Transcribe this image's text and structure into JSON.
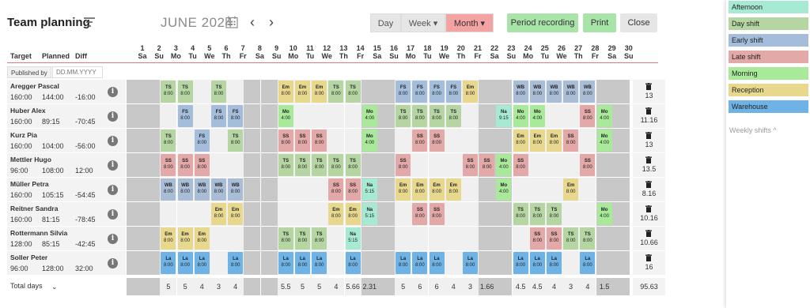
{
  "header": {
    "title": "Team planning",
    "month": "JUNE 2024",
    "prev": "‹",
    "next": "›",
    "views": [
      "Day",
      "Week ▾",
      "Month ▾"
    ],
    "active_view": "Month",
    "period_recording": "Period recording",
    "print": "Print",
    "close": "Close"
  },
  "columns": {
    "target": "Target",
    "planned": "Planned",
    "diff": "Diff"
  },
  "published_by": "Published by",
  "published_placeholder": "DD.MM.YYYY",
  "days": [
    {
      "n": "1",
      "d": "Sa"
    },
    {
      "n": "2",
      "d": "Su"
    },
    {
      "n": "3",
      "d": "Mo"
    },
    {
      "n": "4",
      "d": "Tu"
    },
    {
      "n": "5",
      "d": "We"
    },
    {
      "n": "6",
      "d": "Th"
    },
    {
      "n": "7",
      "d": "Fr"
    },
    {
      "n": "8",
      "d": "Sa"
    },
    {
      "n": "9",
      "d": "Su"
    },
    {
      "n": "10",
      "d": "Mo"
    },
    {
      "n": "11",
      "d": "Tu"
    },
    {
      "n": "12",
      "d": "We"
    },
    {
      "n": "13",
      "d": "Th"
    },
    {
      "n": "14",
      "d": "Fr"
    },
    {
      "n": "15",
      "d": "Sa"
    },
    {
      "n": "16",
      "d": "Su"
    },
    {
      "n": "17",
      "d": "Mo"
    },
    {
      "n": "18",
      "d": "Tu"
    },
    {
      "n": "19",
      "d": "We"
    },
    {
      "n": "20",
      "d": "Th"
    },
    {
      "n": "21",
      "d": "Fr"
    },
    {
      "n": "22",
      "d": "Sa"
    },
    {
      "n": "23",
      "d": "Su"
    },
    {
      "n": "24",
      "d": "Mo"
    },
    {
      "n": "25",
      "d": "Tu"
    },
    {
      "n": "26",
      "d": "We"
    },
    {
      "n": "27",
      "d": "Th"
    },
    {
      "n": "28",
      "d": "Fr"
    },
    {
      "n": "29",
      "d": "Sa"
    },
    {
      "n": "30",
      "d": "Su"
    }
  ],
  "shift_colors": {
    "TS": "#b5d6a3",
    "FS": "#a3bddb",
    "Em": "#e8d88e",
    "SS": "#e3a8a8",
    "WB": "#a9bdd6",
    "La": "#6fb3e6",
    "Mo": "#a8e99a",
    "Na": "#a7ead4"
  },
  "employees": [
    {
      "name": "Aregger Pascal",
      "target": "160:00",
      "planned": "144:00",
      "diff": "-16:00",
      "total": "13",
      "shifts": {
        "3": [
          "TS",
          "8:00"
        ],
        "4": [
          "TS",
          "8:00"
        ],
        "6": [
          "TS",
          "8:00"
        ],
        "10": [
          "Em",
          "8:00"
        ],
        "11": [
          "Em",
          "8:00"
        ],
        "12": [
          "Em",
          "8:00"
        ],
        "13": [
          "TS",
          "8:00"
        ],
        "14": [
          "TS",
          "8:00"
        ],
        "17": [
          "FS",
          "8:00"
        ],
        "18": [
          "FS",
          "8:00"
        ],
        "19": [
          "FS",
          "8:00"
        ],
        "20": [
          "FS",
          "8:00"
        ],
        "21": [
          "Em",
          "8:00"
        ],
        "24": [
          "WB",
          "8:00"
        ],
        "25": [
          "WB",
          "8:00"
        ],
        "26": [
          "WB",
          "8:00"
        ],
        "27": [
          "WB",
          "8:00"
        ],
        "28": [
          "WB",
          "8:00"
        ]
      }
    },
    {
      "name": "Huber Alex",
      "target": "160:00",
      "planned": "89:15",
      "diff": "-70:45",
      "total": "11.16",
      "shifts": {
        "4": [
          "FS",
          "8:00"
        ],
        "6": [
          "FS",
          "8:00"
        ],
        "7": [
          "FS",
          "8:00"
        ],
        "10": [
          "Mo",
          "4:00"
        ],
        "15": [
          "Mo",
          "4:00"
        ],
        "17": [
          "TS",
          "8:00"
        ],
        "18": [
          "TS",
          "8:00"
        ],
        "19": [
          "TS",
          "8:00"
        ],
        "20": [
          "TS",
          "8:00"
        ],
        "23": [
          "Na",
          "9:15"
        ],
        "24": [
          "Mo",
          "4:00"
        ],
        "25": [
          "Mo",
          "4:00"
        ],
        "28": [
          "SS",
          "8:00"
        ],
        "29": [
          "Mo",
          "4:00"
        ]
      }
    },
    {
      "name": "Kurz Pia",
      "target": "160:00",
      "planned": "104:00",
      "diff": "-56:00",
      "total": "13",
      "shifts": {
        "3": [
          "TS",
          "8:00"
        ],
        "5": [
          "FS",
          "8:00"
        ],
        "7": [
          "TS",
          "8:00"
        ],
        "10": [
          "SS",
          "8:00"
        ],
        "11": [
          "SS",
          "8:00"
        ],
        "12": [
          "SS",
          "8:00"
        ],
        "15": [
          "Mo",
          "4:00"
        ],
        "18": [
          "SS",
          "8:00"
        ],
        "19": [
          "SS",
          "8:00"
        ],
        "24": [
          "Em",
          "8:00"
        ],
        "25": [
          "Em",
          "8:00"
        ],
        "26": [
          "Em",
          "8:00"
        ],
        "27": [
          "SS",
          "8:00"
        ],
        "29": [
          "Mo",
          "4:00"
        ]
      }
    },
    {
      "name": "Mettler Hugo",
      "target": "96:00",
      "planned": "108:00",
      "diff": "12:00",
      "total": "13.5",
      "shifts": {
        "3": [
          "SS",
          "8:00"
        ],
        "4": [
          "SS",
          "8:00"
        ],
        "5": [
          "SS",
          "8:00"
        ],
        "10": [
          "TS",
          "8:00"
        ],
        "11": [
          "TS",
          "8:00"
        ],
        "12": [
          "TS",
          "8:00"
        ],
        "13": [
          "TS",
          "8:00"
        ],
        "14": [
          "TS",
          "8:00"
        ],
        "17": [
          "SS",
          "8:00"
        ],
        "21": [
          "SS",
          "8:00"
        ],
        "22": [
          "SS",
          "8:00"
        ],
        "23": [
          "Mo",
          "4:00"
        ],
        "24": [
          "SS",
          "8:00"
        ],
        "28": [
          "SS",
          "8:00"
        ]
      }
    },
    {
      "name": "Müller Petra",
      "target": "160:00",
      "planned": "105:15",
      "diff": "-54:45",
      "total": "8.16",
      "shifts": {
        "3": [
          "WB",
          "8:00"
        ],
        "4": [
          "WB",
          "8:00"
        ],
        "5": [
          "WB",
          "8:00"
        ],
        "6": [
          "WB",
          "8:00"
        ],
        "7": [
          "WB",
          "8:00"
        ],
        "13": [
          "SS",
          "8:00"
        ],
        "14": [
          "SS",
          "8:00"
        ],
        "15": [
          "Na",
          "5:15"
        ],
        "17": [
          "Em",
          "8:00"
        ],
        "18": [
          "Em",
          "8:00"
        ],
        "19": [
          "Em",
          "8:00"
        ],
        "20": [
          "Em",
          "8:00"
        ],
        "23": [
          "Mo",
          "4:00"
        ],
        "27": [
          "Em",
          "8:00"
        ]
      }
    },
    {
      "name": "Reitner Sandra",
      "target": "160:00",
      "planned": "81:15",
      "diff": "-78:45",
      "total": "10.16",
      "shifts": {
        "6": [
          "Em",
          "8:00"
        ],
        "7": [
          "Em",
          "8:00"
        ],
        "13": [
          "Em",
          "8:00"
        ],
        "14": [
          "Em",
          "8:00"
        ],
        "15": [
          "Na",
          "5:15"
        ],
        "18": [
          "SS",
          "8:00"
        ],
        "19": [
          "SS",
          "8:00"
        ],
        "24": [
          "TS",
          "8:00"
        ],
        "25": [
          "TS",
          "8:00"
        ],
        "26": [
          "TS",
          "8:00"
        ],
        "29": [
          "Mo",
          "4:00"
        ]
      }
    },
    {
      "name": "Rottermann Silvia",
      "target": "128:00",
      "planned": "85:15",
      "diff": "-42:45",
      "total": "10.66",
      "shifts": {
        "3": [
          "Em",
          "8:00"
        ],
        "4": [
          "Em",
          "8:00"
        ],
        "5": [
          "Em",
          "8:00"
        ],
        "10": [
          "TS",
          "8:00"
        ],
        "11": [
          "TS",
          "8:00"
        ],
        "12": [
          "TS",
          "8:00"
        ],
        "14": [
          "Na",
          "5:15"
        ],
        "25": [
          "SS",
          "8:00"
        ],
        "26": [
          "SS",
          "8:00"
        ],
        "27": [
          "TS",
          "8:00"
        ],
        "28": [
          "TS",
          "8:00"
        ]
      }
    },
    {
      "name": "Soller Peter",
      "target": "96:00",
      "planned": "128:00",
      "diff": "32:00",
      "total": "16",
      "shifts": {
        "3": [
          "La",
          "8:00"
        ],
        "4": [
          "La",
          "8:00"
        ],
        "5": [
          "La",
          "8:00"
        ],
        "7": [
          "La",
          "8:00"
        ],
        "10": [
          "La",
          "8:00"
        ],
        "11": [
          "La",
          "8:00"
        ],
        "12": [
          "La",
          "8:00"
        ],
        "14": [
          "La",
          "8:00"
        ],
        "17": [
          "La",
          "8:00"
        ],
        "18": [
          "La",
          "8:00"
        ],
        "19": [
          "La",
          "8:00"
        ],
        "21": [
          "La",
          "8:00"
        ],
        "24": [
          "La",
          "8:00"
        ],
        "25": [
          "La",
          "8:00"
        ],
        "26": [
          "La",
          "8:00"
        ],
        "28": [
          "La",
          "8:00"
        ]
      }
    }
  ],
  "total_days_label": "Total days",
  "day_totals": [
    "",
    "",
    "5",
    "5",
    "4",
    "3",
    "4",
    "",
    "",
    "5.5",
    "5",
    "5",
    "4",
    "5.66",
    "2.31",
    "",
    "5",
    "6",
    "6",
    "4",
    "3",
    "1.66",
    "",
    "4.5",
    "4.5",
    "4",
    "3",
    "4",
    "1.5",
    ""
  ],
  "grand_total": "95.63",
  "legend": [
    {
      "label": "Afternoon",
      "color": "#a7ead4"
    },
    {
      "label": "Day shift",
      "color": "#b5d6a3"
    },
    {
      "label": "Early shift",
      "color": "#a3bddb"
    },
    {
      "label": "Late shift",
      "color": "#e3a8a8"
    },
    {
      "label": "Morning",
      "color": "#a8e99a"
    },
    {
      "label": "Reception",
      "color": "#e8d88e"
    },
    {
      "label": "Warehouse",
      "color": "#6fb3e6"
    }
  ],
  "weekly_shifts": "Weekly shifts ^"
}
